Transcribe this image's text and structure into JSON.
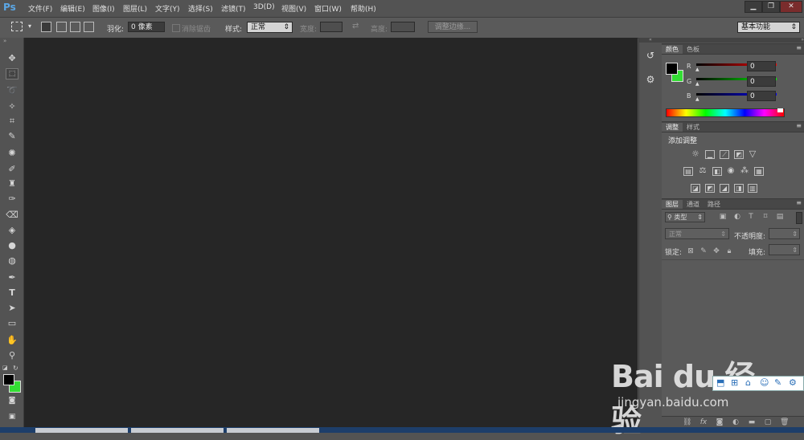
{
  "app": {
    "logo": "Ps"
  },
  "menu": [
    "文件(F)",
    "编辑(E)",
    "图像(I)",
    "图层(L)",
    "文字(Y)",
    "选择(S)",
    "滤镜(T)",
    "3D(D)",
    "视图(V)",
    "窗口(W)",
    "帮助(H)"
  ],
  "window_controls": {
    "minimize": "▁",
    "restore": "❐",
    "close": "✕"
  },
  "options": {
    "feather_label": "羽化:",
    "feather_value": "0 像素",
    "antialias_label": "消除锯齿",
    "style_label": "样式:",
    "style_value": "正常",
    "width_label": "宽度:",
    "height_label": "高度:",
    "refine_button": "调整边缘...",
    "workspace": "基本功能"
  },
  "colors": {
    "foreground": "#000000",
    "background": "#33dd33",
    "accent_blue": "#5ba7e6"
  },
  "color_panel": {
    "tabs": [
      "颜色",
      "色板"
    ],
    "r_label": "R",
    "g_label": "G",
    "b_label": "B",
    "r_value": "0",
    "g_value": "0",
    "b_value": "0"
  },
  "adjust_panel": {
    "tabs": [
      "调整",
      "样式"
    ],
    "title": "添加调整"
  },
  "layers_panel": {
    "tabs": [
      "图层",
      "通道",
      "路径"
    ],
    "filter_kind": "类型",
    "blend_mode": "正常",
    "opacity_label": "不透明度:",
    "lock_label": "锁定:",
    "fill_label": "填充:"
  },
  "watermark": {
    "brand": "Bai du 经验",
    "url": "jingyan.baidu.com"
  }
}
